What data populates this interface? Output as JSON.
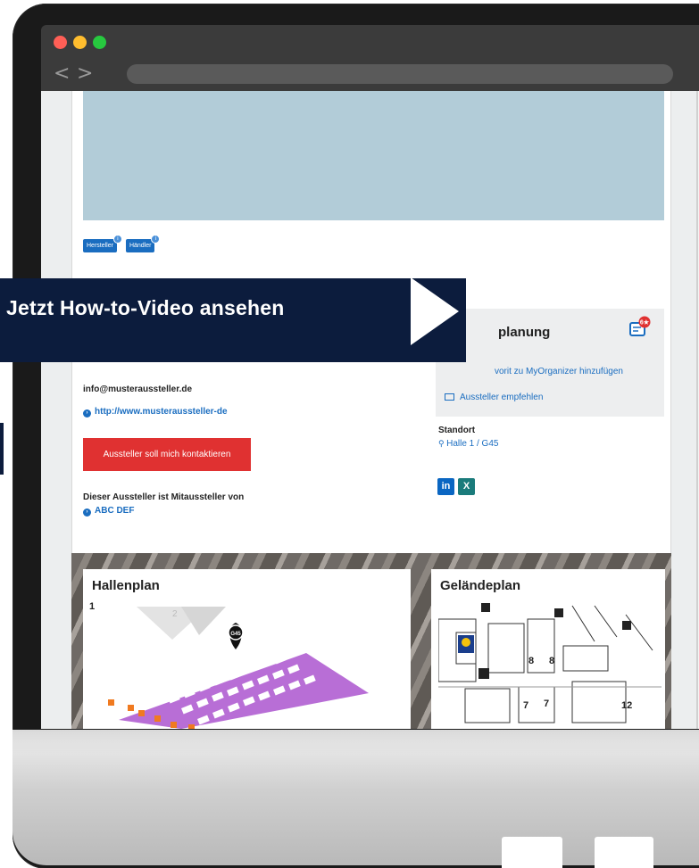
{
  "browser": {
    "back_glyph": "<",
    "forward_glyph": ">"
  },
  "exhibitor": {
    "badges": [
      {
        "label": "Hersteller",
        "icon": "info-dot-icon"
      },
      {
        "label": "Händler",
        "icon": "info-dot-icon"
      }
    ],
    "email": "info@musteraussteller.de",
    "website": "http://www.musteraussteller-de",
    "contact_button": "Aussteller soll mich kontaktieren",
    "co_exhibitor_text": "Dieser Aussteller ist Mitaussteller von",
    "co_exhibitor_link": "ABC DEF"
  },
  "planning": {
    "title": "planung",
    "favorite_link": "vorit zu MyOrganizer hinzufügen",
    "recommend_link": "Aussteller empfehlen",
    "icon": "organizer-icon"
  },
  "location": {
    "label": "Standort",
    "value": "Halle 1 / G45"
  },
  "social": {
    "linkedin": "in",
    "xing": "X"
  },
  "maps": {
    "hall_title": "Hallenplan",
    "hall_number": "1",
    "hall_neighbor": "2",
    "hall_marker": "G45",
    "site_title": "Geländeplan",
    "site_labels": [
      "8",
      "8",
      "7",
      "7",
      "12"
    ]
  },
  "overlay": {
    "cta_text": "Jetzt How-to-Video ansehen"
  },
  "colors": {
    "accent_blue": "#1a6dc0",
    "button_red": "#e03131",
    "banner_navy": "#0c1c3d",
    "hero_blue": "#b2ccd8",
    "hall_purple": "#b86ed6"
  }
}
